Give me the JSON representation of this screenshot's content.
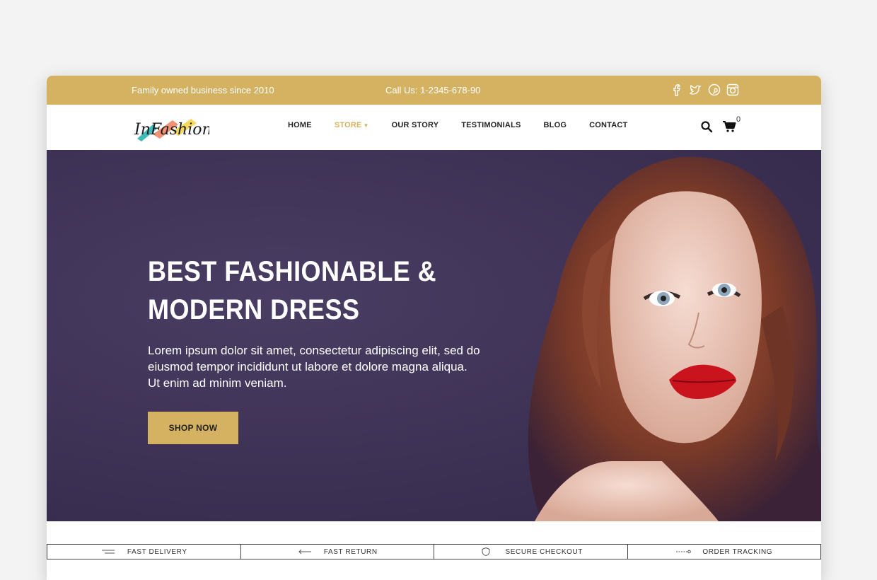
{
  "topbar": {
    "tagline": "Family owned business since 2010",
    "phone": "Call Us: 1-2345-678-90",
    "socials": [
      "facebook-icon",
      "twitter-icon",
      "pinterest-icon",
      "instagram-icon"
    ]
  },
  "header": {
    "logo_text": "InFashion",
    "nav": [
      {
        "label": "HOME",
        "active": false
      },
      {
        "label": "STORE",
        "active": true,
        "dropdown": true
      },
      {
        "label": "OUR STORY",
        "active": false
      },
      {
        "label": "TESTIMONIALS",
        "active": false
      },
      {
        "label": "BLOG",
        "active": false
      },
      {
        "label": "CONTACT",
        "active": false
      }
    ],
    "cart_count": "0"
  },
  "hero": {
    "title_line1": "BEST FASHIONABLE &",
    "title_line2": "MODERN DRESS",
    "body": "Lorem ipsum dolor sit amet, consectetur adipiscing elit, sed do eiusmod tempor incididunt ut labore et dolore magna aliqua. Ut enim ad minim veniam.",
    "cta": "SHOP NOW"
  },
  "features": [
    {
      "label": "FAST DELIVERY",
      "icon": "delivery-icon"
    },
    {
      "label": "FAST RETURN",
      "icon": "return-icon"
    },
    {
      "label": "SECURE CHECKOUT",
      "icon": "shield-icon"
    },
    {
      "label": "ORDER TRACKING",
      "icon": "tracking-icon"
    }
  ],
  "colors": {
    "accent": "#d4b262",
    "hero_bg": "#3d3154",
    "page_bg": "#f3f3f3"
  }
}
